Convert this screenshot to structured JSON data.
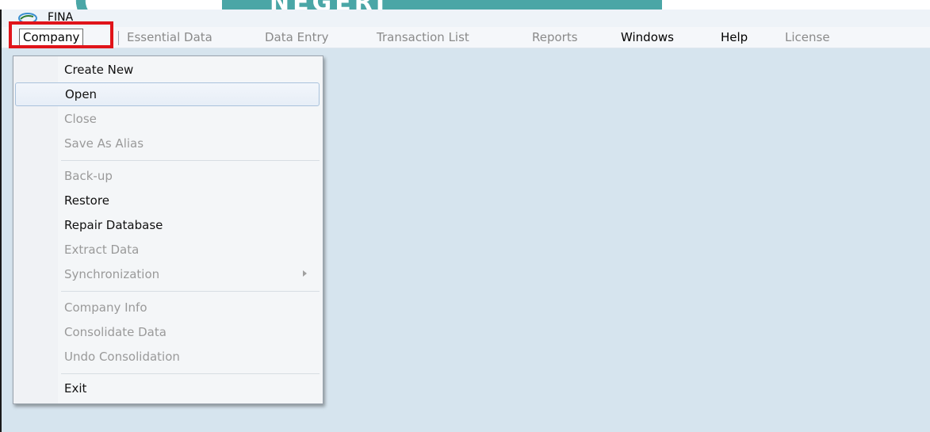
{
  "window": {
    "title": "FINA"
  },
  "watermark": {
    "text": "NEGERI"
  },
  "menubar": {
    "items": [
      {
        "label": "Company",
        "enabled": true
      },
      {
        "label": "Essential Data",
        "enabled": false
      },
      {
        "label": "Data Entry",
        "enabled": false
      },
      {
        "label": "Transaction List",
        "enabled": false
      },
      {
        "label": "Reports",
        "enabled": false
      },
      {
        "label": "Windows",
        "enabled": true
      },
      {
        "label": "Help",
        "enabled": true
      },
      {
        "label": "License",
        "enabled": false
      }
    ]
  },
  "company_menu": {
    "items": [
      {
        "label": "Create New",
        "enabled": true
      },
      {
        "label": "Open",
        "enabled": true,
        "highlighted": true
      },
      {
        "label": "Close",
        "enabled": false
      },
      {
        "label": "Save As Alias",
        "enabled": false
      },
      {
        "label": "Back-up",
        "enabled": false
      },
      {
        "label": "Restore",
        "enabled": true
      },
      {
        "label": "Repair Database",
        "enabled": true
      },
      {
        "label": "Extract Data",
        "enabled": false
      },
      {
        "label": "Synchronization",
        "enabled": false,
        "has_submenu": true
      },
      {
        "label": "Company Info",
        "enabled": false
      },
      {
        "label": "Consolidate Data",
        "enabled": false
      },
      {
        "label": "Undo Consolidation",
        "enabled": false
      },
      {
        "label": "Exit",
        "enabled": true
      }
    ]
  },
  "colors": {
    "workspace": "#d6e4ee",
    "highlight_box": "#e0141a",
    "disabled_text": "#8a8a8a",
    "watermark_teal": "#4aa6a6"
  }
}
